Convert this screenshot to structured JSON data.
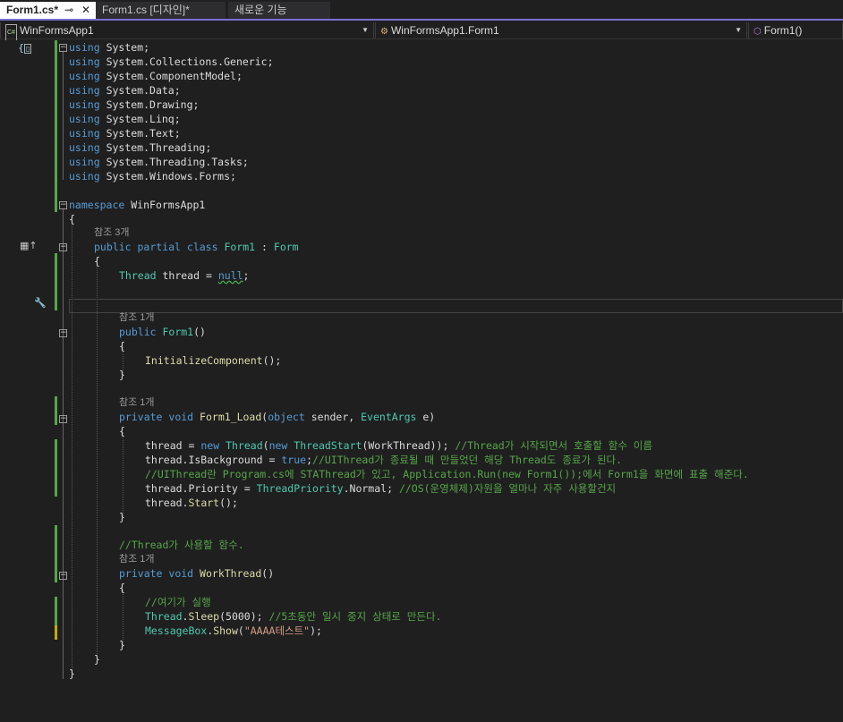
{
  "tabs": [
    {
      "label": "Form1.cs*",
      "pin": "⊸",
      "close": "✕"
    },
    {
      "label": "Form1.cs [디자인]*"
    },
    {
      "label": "새로운 기능"
    }
  ],
  "nav": {
    "project": "WinFormsApp1",
    "project_icon": "C#",
    "class": "WinFormsApp1.Form1",
    "member": "Form1()"
  },
  "code": {
    "l1_kw": "using",
    "l1_ns": "System;",
    "l2_kw": "using",
    "l2_ns": "System.Collections.Generic;",
    "l3_kw": "using",
    "l3_ns": "System.ComponentModel;",
    "l4_kw": "using",
    "l4_ns": "System.Data;",
    "l5_kw": "using",
    "l5_ns": "System.Drawing;",
    "l6_kw": "using",
    "l6_ns": "System.Linq;",
    "l7_kw": "using",
    "l7_ns": "System.Text;",
    "l8_kw": "using",
    "l8_ns": "System.Threading;",
    "l9_kw": "using",
    "l9_ns": "System.Threading.Tasks;",
    "l10_kw": "using",
    "l10_ns": "System.Windows.Forms;",
    "ns_kw": "namespace",
    "ns_name": "WinFormsApp1",
    "brace_open": "{",
    "brace_close": "}",
    "ref3": "참조 3개",
    "ref1": "참조 1개",
    "cls_kw1": "public",
    "cls_kw2": "partial",
    "cls_kw3": "class",
    "cls_name": "Form1",
    "cls_colon": ":",
    "cls_base": "Form",
    "f_type": "Thread",
    "f_name": "thread",
    "f_eq": "=",
    "f_null": "null",
    "f_semi": ";",
    "ctor_kw": "public",
    "ctor_name": "Form1",
    "ctor_paren": "()",
    "init_call": "InitializeComponent",
    "init_rest": "();",
    "load_kw1": "private",
    "load_kw2": "void",
    "load_name": "Form1_Load",
    "load_p1": "(",
    "load_kw3": "object",
    "load_p2": "sender,",
    "load_ty": "EventArgs",
    "load_p3": "e)",
    "t1_a": "thread",
    "t1_b": "=",
    "t1_kw": "new",
    "t1_ty": "Thread",
    "t1_c": "(",
    "t1_kw2": "new",
    "t1_ty2": "ThreadStart",
    "t1_d": "(WorkThread));",
    "t1_cm": "//Thread가 시작되면서 호출할 함수 이름",
    "t2_a": "thread.IsBackground",
    "t2_b": "=",
    "t2_kw": "true",
    "t2_c": ";",
    "t2_cm": "//UIThread가 종료될 때 만들었던 해당 Thread도 종료가 된다.",
    "t3_cm": "//UIThread란 Program.cs에 STAThread가 있고, Application.Run(new Form1());에서 Form1을 화면에 표출 해준다.",
    "t4_a": "thread.Priority",
    "t4_b": "=",
    "t4_ty": "ThreadPriority",
    "t4_c": ".Normal;",
    "t4_cm": "//OS(운영체제)자원을 얼마나 자주 사용할건지",
    "t5_a": "thread.",
    "t5_me": "Start",
    "t5_b": "();",
    "wt_cm": "//Thread가 사용할 함수.",
    "wt_kw1": "private",
    "wt_kw2": "void",
    "wt_name": "WorkThread",
    "wt_paren": "()",
    "w1_cm": "//여기가 실행",
    "w2_ty": "Thread",
    "w2_a": ".",
    "w2_me": "Sleep",
    "w2_b": "(5000);",
    "w2_cm": "//5초동안 일시 중지 상태로 만든다.",
    "w3_ty": "MessageBox",
    "w3_a": ".",
    "w3_me": "Show",
    "w3_b": "(",
    "w3_st": "\"AAAA테스트\"",
    "w3_c": ");"
  }
}
